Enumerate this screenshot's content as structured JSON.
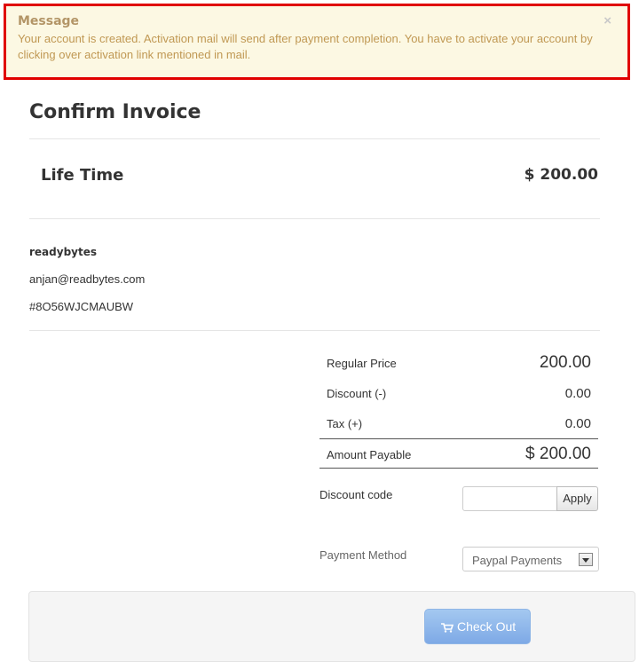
{
  "alert": {
    "title": "Message",
    "body": "Your account is created. Activation mail will send after payment completion. You have to activate your account by clicking over activation link mentioned in mail.",
    "close": "×"
  },
  "invoice": {
    "title": "Confirm Invoice",
    "plan_name": "Life Time",
    "plan_price": "$ 200.00"
  },
  "buyer": {
    "name": "readybytes",
    "email": "anjan@readbytes.com",
    "invoice_key": "#8O56WJCMAUBW"
  },
  "totals": {
    "regular_price_label": "Regular Price",
    "regular_price": "200.00",
    "discount_label": "Discount (-)",
    "discount": "0.00",
    "tax_label": "Tax (+)",
    "tax": "0.00",
    "payable_label": "Amount Payable",
    "payable": "$ 200.00"
  },
  "discount_code": {
    "label": "Discount code",
    "value": "",
    "apply_label": "Apply"
  },
  "payment_method": {
    "label": "Payment Method",
    "selected": "Paypal Payments"
  },
  "checkout": {
    "label": "Check Out",
    "icon": "cart-icon"
  },
  "colors": {
    "alert_border": "#e00000",
    "alert_bg": "#fcf8e3",
    "alert_text": "#c09853",
    "checkout_bg": "#7ea9e6"
  }
}
